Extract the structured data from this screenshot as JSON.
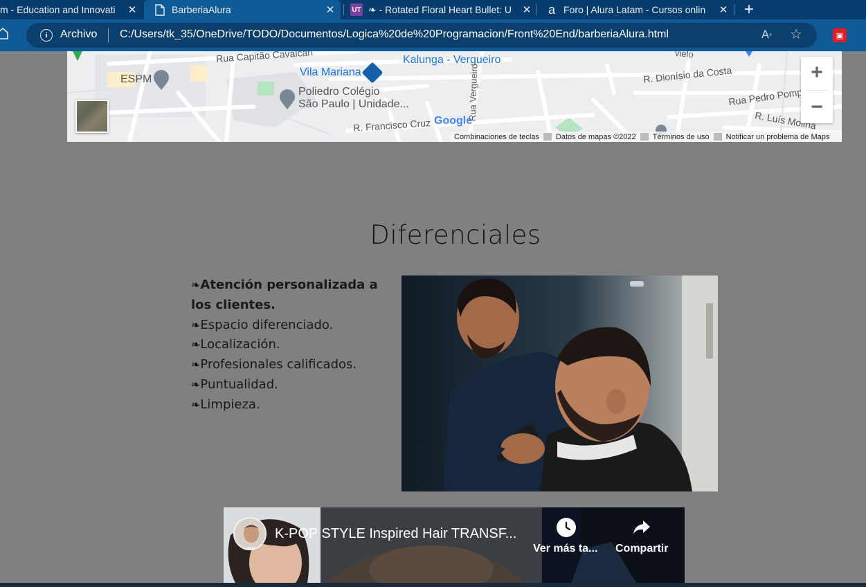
{
  "browser": {
    "tabs": [
      {
        "title": "m - Education and Innovati",
        "icon": "close-only",
        "active": false
      },
      {
        "title": "BarberiaAlura",
        "icon": "page-icon",
        "active": true
      },
      {
        "title": "❧ - Rotated Floral Heart Bullet: U",
        "icon": "ut-icon",
        "active": false
      },
      {
        "title": "Foro | Alura Latam - Cursos onlin",
        "icon": "alura-icon",
        "active": false
      }
    ],
    "tab_close_glyph": "✕",
    "new_tab_glyph": "+",
    "address": {
      "scheme_label": "Archivo",
      "url": "C:/Users/tk_35/OneDrive/TODO/Documentos/Logica%20de%20Programacion/Front%20End/barberiaAlura.html"
    },
    "ut_badge": "UT",
    "alura_badge": "a"
  },
  "map": {
    "labels": {
      "capitao": "Rua Capitão Cavalcan",
      "espm": "ESPM",
      "vila_mariana": "Vila Mariana",
      "kalunga": "Kalunga - Vergueiro",
      "poliedro_1": "Poliedro Colégio",
      "poliedro_2": "São Paulo | Unidade...",
      "dionisio": "R. Dionísio da Costa",
      "pedro_pomp": "Rua Pedro Pomp",
      "luis_molina": "R. Luís Molina",
      "francisco_cruz": "R. Francisco Cruz",
      "vergueiro": "Rua Vergueiro",
      "vielo": "vielo"
    },
    "google_logo": "Google",
    "zoom_in": "+",
    "zoom_out": "−",
    "footer": {
      "shortcuts": "Combinaciones de teclas",
      "data": "Datos de mapas ©2022",
      "terms": "Términos de uso",
      "report": "Notificar un problema de Maps"
    }
  },
  "section": {
    "heading": "Diferenciales",
    "bullet": "❧",
    "items": [
      "Atención personalizada a los clientes.",
      "Espacio diferenciado.",
      "Localización.",
      "Profesionales calificados.",
      "Puntualidad.",
      "Limpieza."
    ]
  },
  "video": {
    "title": "K-POP STYLE Inspired Hair TRANSF...",
    "watch_later": "Ver más ta...",
    "share": "Compartir"
  }
}
